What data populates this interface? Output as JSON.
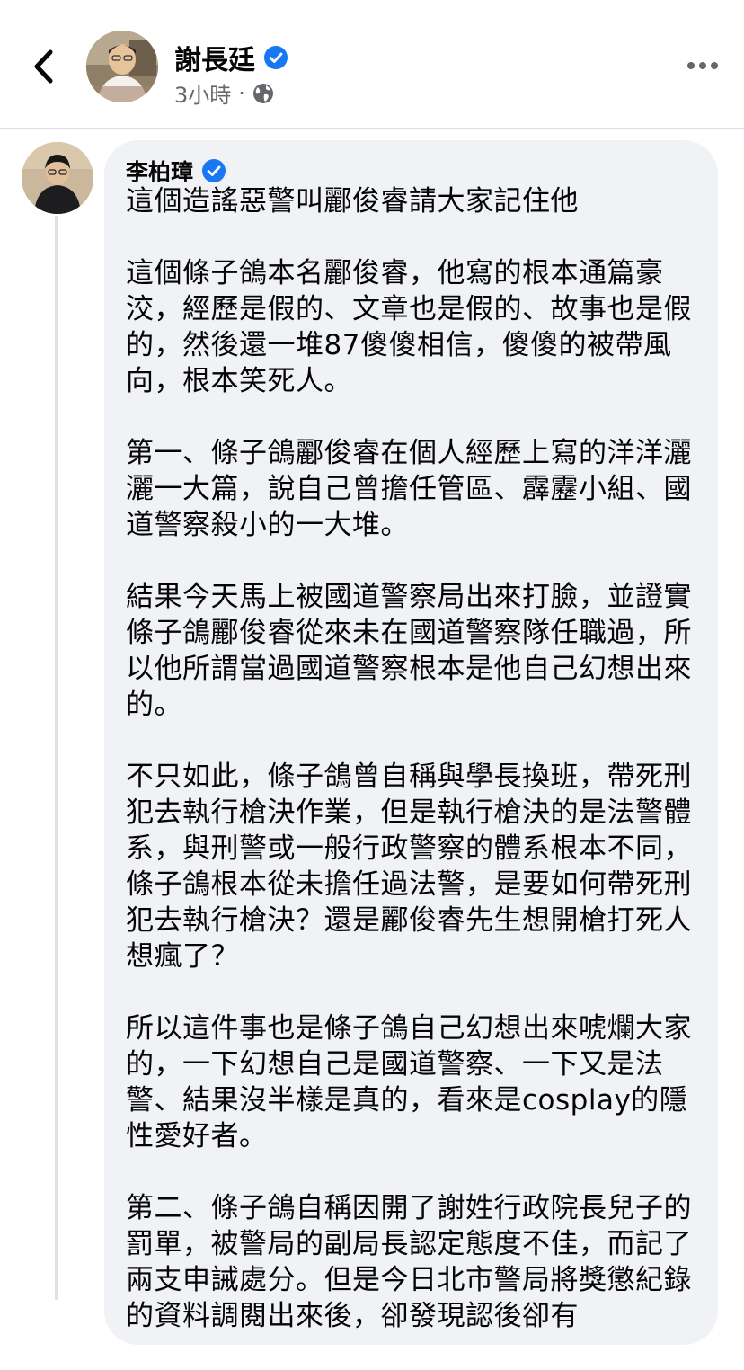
{
  "header": {
    "author_name": "謝長廷",
    "post_time": "3小時",
    "separator": "·"
  },
  "comment": {
    "author_name": "李柏璋",
    "paragraphs": [
      "這個造謠惡警叫酈俊睿請大家記住他",
      "這個條子鴿本名酈俊睿，他寫的根本通篇豪洨，經歷是假的、文章也是假的、故事也是假的，然後還一堆87傻傻相信，傻傻的被帶風向，根本笑死人。",
      "第一、條子鴿酈俊睿在個人經歷上寫的洋洋灑灑一大篇，說自己曾擔任管區、霹靂小組、國道警察殺小的一大堆。",
      "結果今天馬上被國道警察局出來打臉，並證實條子鴿酈俊睿從來未在國道警察隊任職過，所以他所謂當過國道警察根本是他自己幻想出來的。",
      "不只如此，條子鴿曾自稱與學長換班，帶死刑犯去執行槍決作業，但是執行槍決的是法警體系，與刑警或一般行政警察的體系根本不同，條子鴿根本從未擔任過法警，是要如何帶死刑犯去執行槍決？還是酈俊睿先生想開槍打死人想瘋了？",
      "所以這件事也是條子鴿自己幻想出來唬爛大家的，一下幻想自己是國道警察、一下又是法警、結果沒半樣是真的，看來是cosplay的隱性愛好者。",
      "第二、條子鴿自稱因開了謝姓行政院長兒子的罰單，被警局的副局長認定態度不佳，而記了兩支申誡處分。但是今日北市警局將獎懲紀錄的資料調閱出來後，卻發現認後卻有"
    ]
  },
  "icons": {
    "back": "chevron-left-icon",
    "verified": "verified-badge-icon",
    "audience": "globe-icon",
    "more": "more-horizontal-icon"
  },
  "colors": {
    "verified_blue": "#1877f2",
    "bubble_bg": "#f0f2f5",
    "meta_gray": "#65676b"
  }
}
